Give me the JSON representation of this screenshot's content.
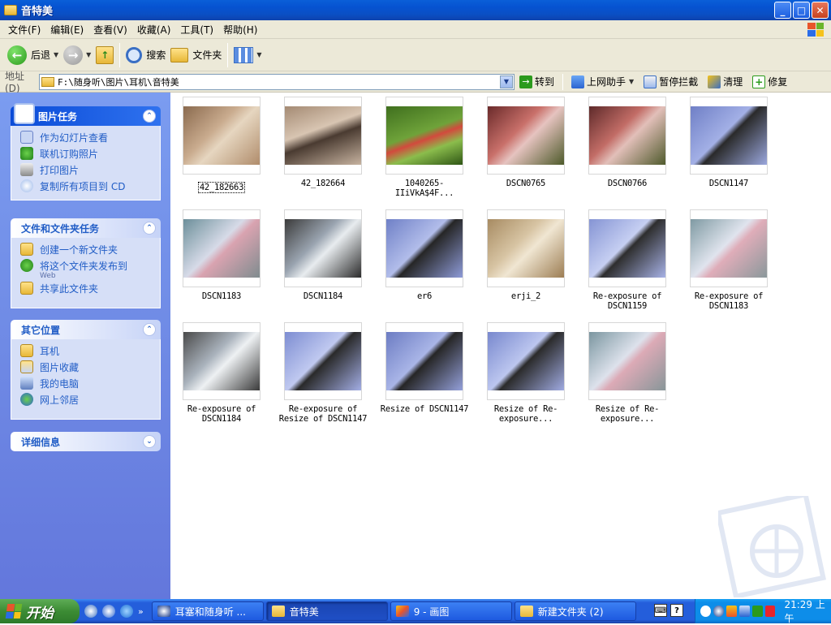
{
  "window": {
    "title": "音特美",
    "btn_min": "_",
    "btn_max": "□",
    "btn_close": "✕"
  },
  "menu": [
    "文件(F)",
    "编辑(E)",
    "查看(V)",
    "收藏(A)",
    "工具(T)",
    "帮助(H)"
  ],
  "toolbar": {
    "back": "后退",
    "search": "搜索",
    "folders": "文件夹"
  },
  "address": {
    "label": "地址(D)",
    "path": "F:\\随身听\\图片\\耳机\\音特美",
    "go": "转到",
    "helper": "上网助手",
    "block": "暂停拦截",
    "clean": "清理",
    "repair": "修复"
  },
  "sidebar": {
    "picture_tasks": {
      "title": "图片任务",
      "items": [
        "作为幻灯片查看",
        "联机订购照片",
        "打印图片",
        "复制所有项目到 CD"
      ]
    },
    "file_tasks": {
      "title": "文件和文件夹任务",
      "items": [
        "创建一个新文件夹",
        "将这个文件夹发布到",
        "共享此文件夹"
      ],
      "web_sub": "Web"
    },
    "other_places": {
      "title": "其它位置",
      "items": [
        "耳机",
        "图片收藏",
        "我的电脑",
        "网上邻居"
      ]
    },
    "details": {
      "title": "详细信息"
    }
  },
  "thumbnails": [
    {
      "label": "42_182663",
      "bg": "linear-gradient(135deg,#8a6a4e,#c9ab8e 40%,#e6d6c0 55%,#b08c6b)",
      "selected": true
    },
    {
      "label": "42_182664",
      "bg": "linear-gradient(160deg,#a48a73,#d8c5b2 40%,#4a3b31 55%,#c7b3a0)"
    },
    {
      "label": "1040265-IIiVkA$4F...",
      "bg": "linear-gradient(160deg,#3f6f1e,#6fa33a 45%,#d24a3d 55%,#8bbd4c 70%,#2f5615)"
    },
    {
      "label": "DSCN0765",
      "bg": "linear-gradient(135deg,#6a2a2a,#c9706a 40%,#e6c3c0 55%,#4d5a2a)"
    },
    {
      "label": "DSCN0766",
      "bg": "linear-gradient(135deg,#5e2a2a,#c26c66 40%,#e2bfb9 55%,#4f5a2c)"
    },
    {
      "label": "DSCN1147",
      "bg": "linear-gradient(135deg,#6f7fc6,#a3b0e6 45%,#2a2a2a 52%,#9aa7dd)"
    },
    {
      "label": "DSCN1183",
      "bg": "linear-gradient(135deg,#6c8f9a,#d7dbe8 45%,#d9a3b0 55%,#7f8c8f)"
    },
    {
      "label": "DSCN1184",
      "bg": "linear-gradient(135deg,#3b3b3b,#9aa4b0 40%,#e8ecef 55%,#2b2b2b)"
    },
    {
      "label": "er6",
      "bg": "linear-gradient(135deg,#6f80c7,#b2bdea 45%,#262626 52%,#8e9bd8)"
    },
    {
      "label": "erji_2",
      "bg": "linear-gradient(135deg,#a78b62,#d7c4a3 40%,#f0e6d2 55%,#9c7d53)"
    },
    {
      "label": "Re-exposure of DSCN1159",
      "bg": "linear-gradient(135deg,#8594d4,#c6cff2 45%,#2e2e2e 52%,#a7b2e6)"
    },
    {
      "label": "Re-exposure of DSCN1183",
      "bg": "linear-gradient(135deg,#7f9aa3,#e0e4ee 45%,#dfadb9 55%,#8a989b)"
    },
    {
      "label": "Re-exposure of DSCN1184",
      "bg": "linear-gradient(135deg,#4a4a4a,#aab3bd 40%,#eef1f3 55%,#3a3a3a)"
    },
    {
      "label": "Re-exposure of Resize of DSCN1147",
      "bg": "linear-gradient(135deg,#7d8dd2,#c0c9f0 45%,#2a2a2a 52%,#a3aee5)"
    },
    {
      "label": "Resize of DSCN1147",
      "bg": "linear-gradient(135deg,#6c7cc3,#a9b5e7 45%,#262626 52%,#94a0da)"
    },
    {
      "label": "Resize of Re-exposure...",
      "bg": "linear-gradient(135deg,#7888ce,#bcc6ef 45%,#2b2b2b 52%,#a0abe2)"
    },
    {
      "label": "Resize of Re-exposure...",
      "bg": "linear-gradient(135deg,#7b96a0,#dde2ec 45%,#dcaab6 55%,#889699)"
    }
  ],
  "taskbar": {
    "start": "开始",
    "tasks": [
      "耳塞和随身听 ...",
      "音特美",
      "9 - 画图",
      "新建文件夹 (2)"
    ],
    "clock": "21:29 上午",
    "lang": "?"
  }
}
